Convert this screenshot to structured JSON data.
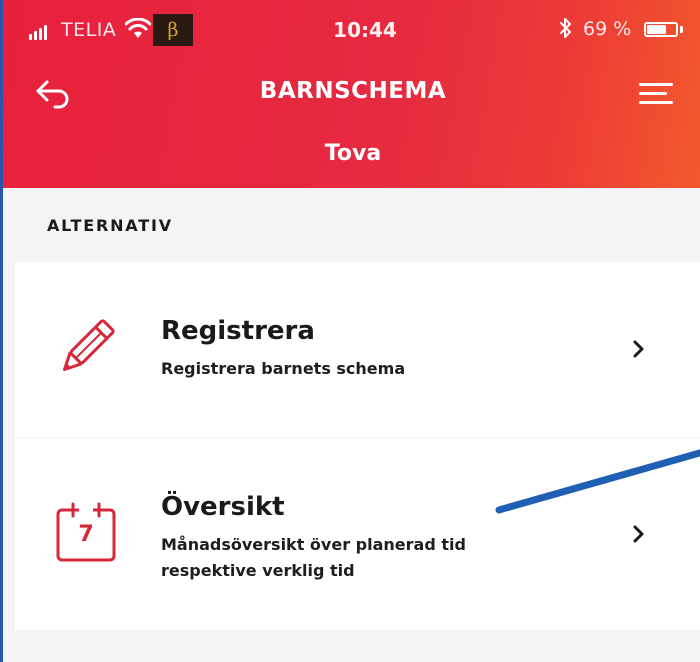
{
  "status_bar": {
    "carrier": "TELIA",
    "beta": "β",
    "time": "10:44",
    "bluetooth_icon": "bluetooth-icon",
    "battery_percent": "69 %",
    "battery_level": 0.69
  },
  "nav": {
    "back_icon": "back-arrow-icon",
    "title": "BARNSCHEMA",
    "menu_icon": "hamburger-menu-icon",
    "subtitle": "Tova"
  },
  "content": {
    "section_label": "ALTERNATIV",
    "options": [
      {
        "icon": "pencil-icon",
        "title": "Registrera",
        "description": "Registrera barnets schema"
      },
      {
        "icon": "calendar-icon",
        "calendar_day": "7",
        "title": "Översikt",
        "description": "Månadsöversikt över planerad tid respektive verklig tid"
      }
    ]
  },
  "colors": {
    "header_red": "#e8203c",
    "header_orange": "#f25a2c",
    "icon_red": "#d6283a",
    "annotation_blue": "#1f5fb4"
  }
}
